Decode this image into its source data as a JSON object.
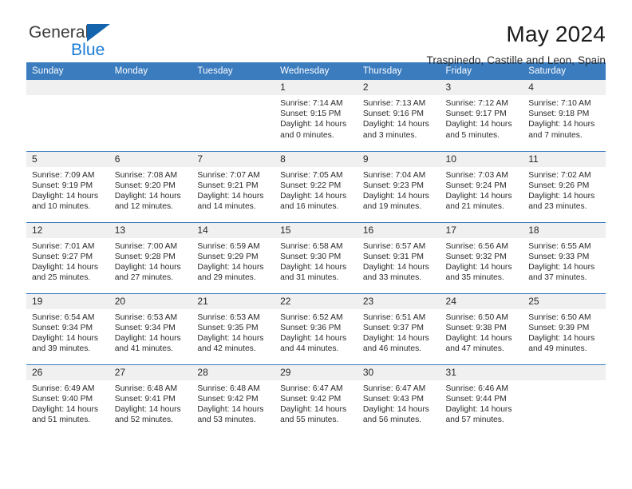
{
  "brand": {
    "name_part1": "General",
    "name_part2": "Blue",
    "triangle_color": "#1464ad",
    "blue_text_color": "#1c7cd6"
  },
  "header": {
    "month_title": "May 2024",
    "location": "Traspinedo, Castille and Leon, Spain"
  },
  "theme": {
    "header_band_color": "#3b7cbf",
    "daynum_band_color": "#f0f0f0",
    "cell_border_color": "#3b7cbf"
  },
  "calendar": {
    "weekday_headers": [
      "Sunday",
      "Monday",
      "Tuesday",
      "Wednesday",
      "Thursday",
      "Friday",
      "Saturday"
    ],
    "weeks": [
      [
        {
          "day": "",
          "empty": true,
          "sunrise": "",
          "sunset": "",
          "daylight_line1": "",
          "daylight_line2": ""
        },
        {
          "day": "",
          "empty": true,
          "sunrise": "",
          "sunset": "",
          "daylight_line1": "",
          "daylight_line2": ""
        },
        {
          "day": "",
          "empty": true,
          "sunrise": "",
          "sunset": "",
          "daylight_line1": "",
          "daylight_line2": ""
        },
        {
          "day": "1",
          "sunrise": "Sunrise: 7:14 AM",
          "sunset": "Sunset: 9:15 PM",
          "daylight_line1": "Daylight: 14 hours",
          "daylight_line2": "and 0 minutes."
        },
        {
          "day": "2",
          "sunrise": "Sunrise: 7:13 AM",
          "sunset": "Sunset: 9:16 PM",
          "daylight_line1": "Daylight: 14 hours",
          "daylight_line2": "and 3 minutes."
        },
        {
          "day": "3",
          "sunrise": "Sunrise: 7:12 AM",
          "sunset": "Sunset: 9:17 PM",
          "daylight_line1": "Daylight: 14 hours",
          "daylight_line2": "and 5 minutes."
        },
        {
          "day": "4",
          "sunrise": "Sunrise: 7:10 AM",
          "sunset": "Sunset: 9:18 PM",
          "daylight_line1": "Daylight: 14 hours",
          "daylight_line2": "and 7 minutes."
        }
      ],
      [
        {
          "day": "5",
          "sunrise": "Sunrise: 7:09 AM",
          "sunset": "Sunset: 9:19 PM",
          "daylight_line1": "Daylight: 14 hours",
          "daylight_line2": "and 10 minutes."
        },
        {
          "day": "6",
          "sunrise": "Sunrise: 7:08 AM",
          "sunset": "Sunset: 9:20 PM",
          "daylight_line1": "Daylight: 14 hours",
          "daylight_line2": "and 12 minutes."
        },
        {
          "day": "7",
          "sunrise": "Sunrise: 7:07 AM",
          "sunset": "Sunset: 9:21 PM",
          "daylight_line1": "Daylight: 14 hours",
          "daylight_line2": "and 14 minutes."
        },
        {
          "day": "8",
          "sunrise": "Sunrise: 7:05 AM",
          "sunset": "Sunset: 9:22 PM",
          "daylight_line1": "Daylight: 14 hours",
          "daylight_line2": "and 16 minutes."
        },
        {
          "day": "9",
          "sunrise": "Sunrise: 7:04 AM",
          "sunset": "Sunset: 9:23 PM",
          "daylight_line1": "Daylight: 14 hours",
          "daylight_line2": "and 19 minutes."
        },
        {
          "day": "10",
          "sunrise": "Sunrise: 7:03 AM",
          "sunset": "Sunset: 9:24 PM",
          "daylight_line1": "Daylight: 14 hours",
          "daylight_line2": "and 21 minutes."
        },
        {
          "day": "11",
          "sunrise": "Sunrise: 7:02 AM",
          "sunset": "Sunset: 9:26 PM",
          "daylight_line1": "Daylight: 14 hours",
          "daylight_line2": "and 23 minutes."
        }
      ],
      [
        {
          "day": "12",
          "sunrise": "Sunrise: 7:01 AM",
          "sunset": "Sunset: 9:27 PM",
          "daylight_line1": "Daylight: 14 hours",
          "daylight_line2": "and 25 minutes."
        },
        {
          "day": "13",
          "sunrise": "Sunrise: 7:00 AM",
          "sunset": "Sunset: 9:28 PM",
          "daylight_line1": "Daylight: 14 hours",
          "daylight_line2": "and 27 minutes."
        },
        {
          "day": "14",
          "sunrise": "Sunrise: 6:59 AM",
          "sunset": "Sunset: 9:29 PM",
          "daylight_line1": "Daylight: 14 hours",
          "daylight_line2": "and 29 minutes."
        },
        {
          "day": "15",
          "sunrise": "Sunrise: 6:58 AM",
          "sunset": "Sunset: 9:30 PM",
          "daylight_line1": "Daylight: 14 hours",
          "daylight_line2": "and 31 minutes."
        },
        {
          "day": "16",
          "sunrise": "Sunrise: 6:57 AM",
          "sunset": "Sunset: 9:31 PM",
          "daylight_line1": "Daylight: 14 hours",
          "daylight_line2": "and 33 minutes."
        },
        {
          "day": "17",
          "sunrise": "Sunrise: 6:56 AM",
          "sunset": "Sunset: 9:32 PM",
          "daylight_line1": "Daylight: 14 hours",
          "daylight_line2": "and 35 minutes."
        },
        {
          "day": "18",
          "sunrise": "Sunrise: 6:55 AM",
          "sunset": "Sunset: 9:33 PM",
          "daylight_line1": "Daylight: 14 hours",
          "daylight_line2": "and 37 minutes."
        }
      ],
      [
        {
          "day": "19",
          "sunrise": "Sunrise: 6:54 AM",
          "sunset": "Sunset: 9:34 PM",
          "daylight_line1": "Daylight: 14 hours",
          "daylight_line2": "and 39 minutes."
        },
        {
          "day": "20",
          "sunrise": "Sunrise: 6:53 AM",
          "sunset": "Sunset: 9:34 PM",
          "daylight_line1": "Daylight: 14 hours",
          "daylight_line2": "and 41 minutes."
        },
        {
          "day": "21",
          "sunrise": "Sunrise: 6:53 AM",
          "sunset": "Sunset: 9:35 PM",
          "daylight_line1": "Daylight: 14 hours",
          "daylight_line2": "and 42 minutes."
        },
        {
          "day": "22",
          "sunrise": "Sunrise: 6:52 AM",
          "sunset": "Sunset: 9:36 PM",
          "daylight_line1": "Daylight: 14 hours",
          "daylight_line2": "and 44 minutes."
        },
        {
          "day": "23",
          "sunrise": "Sunrise: 6:51 AM",
          "sunset": "Sunset: 9:37 PM",
          "daylight_line1": "Daylight: 14 hours",
          "daylight_line2": "and 46 minutes."
        },
        {
          "day": "24",
          "sunrise": "Sunrise: 6:50 AM",
          "sunset": "Sunset: 9:38 PM",
          "daylight_line1": "Daylight: 14 hours",
          "daylight_line2": "and 47 minutes."
        },
        {
          "day": "25",
          "sunrise": "Sunrise: 6:50 AM",
          "sunset": "Sunset: 9:39 PM",
          "daylight_line1": "Daylight: 14 hours",
          "daylight_line2": "and 49 minutes."
        }
      ],
      [
        {
          "day": "26",
          "sunrise": "Sunrise: 6:49 AM",
          "sunset": "Sunset: 9:40 PM",
          "daylight_line1": "Daylight: 14 hours",
          "daylight_line2": "and 51 minutes."
        },
        {
          "day": "27",
          "sunrise": "Sunrise: 6:48 AM",
          "sunset": "Sunset: 9:41 PM",
          "daylight_line1": "Daylight: 14 hours",
          "daylight_line2": "and 52 minutes."
        },
        {
          "day": "28",
          "sunrise": "Sunrise: 6:48 AM",
          "sunset": "Sunset: 9:42 PM",
          "daylight_line1": "Daylight: 14 hours",
          "daylight_line2": "and 53 minutes."
        },
        {
          "day": "29",
          "sunrise": "Sunrise: 6:47 AM",
          "sunset": "Sunset: 9:42 PM",
          "daylight_line1": "Daylight: 14 hours",
          "daylight_line2": "and 55 minutes."
        },
        {
          "day": "30",
          "sunrise": "Sunrise: 6:47 AM",
          "sunset": "Sunset: 9:43 PM",
          "daylight_line1": "Daylight: 14 hours",
          "daylight_line2": "and 56 minutes."
        },
        {
          "day": "31",
          "sunrise": "Sunrise: 6:46 AM",
          "sunset": "Sunset: 9:44 PM",
          "daylight_line1": "Daylight: 14 hours",
          "daylight_line2": "and 57 minutes."
        },
        {
          "day": "",
          "empty": true,
          "sunrise": "",
          "sunset": "",
          "daylight_line1": "",
          "daylight_line2": ""
        }
      ]
    ]
  }
}
